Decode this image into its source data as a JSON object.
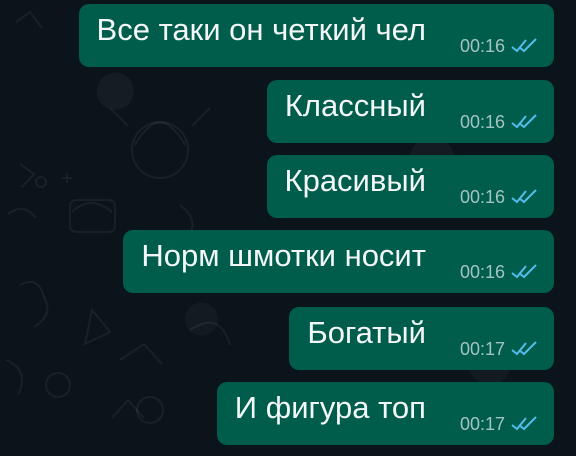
{
  "chat": {
    "messages": [
      {
        "text": "Все таки он четкий чел",
        "time": "00:16",
        "status_icon": "double-check-read"
      },
      {
        "text": "Классный",
        "time": "00:16",
        "status_icon": "double-check-read"
      },
      {
        "text": "Красивый",
        "time": "00:16",
        "status_icon": "double-check-read"
      },
      {
        "text": "Норм шмотки носит",
        "time": "00:16",
        "status_icon": "double-check-read"
      },
      {
        "text": "Богатый",
        "time": "00:17",
        "status_icon": "double-check-read"
      },
      {
        "text": "И фигура топ",
        "time": "00:17",
        "status_icon": "double-check-read"
      }
    ]
  },
  "theme": {
    "background": "#0b141a",
    "outgoing_bubble": "#005c4b",
    "message_text": "#f4f7f8",
    "read_tick": "#53bdeb"
  }
}
